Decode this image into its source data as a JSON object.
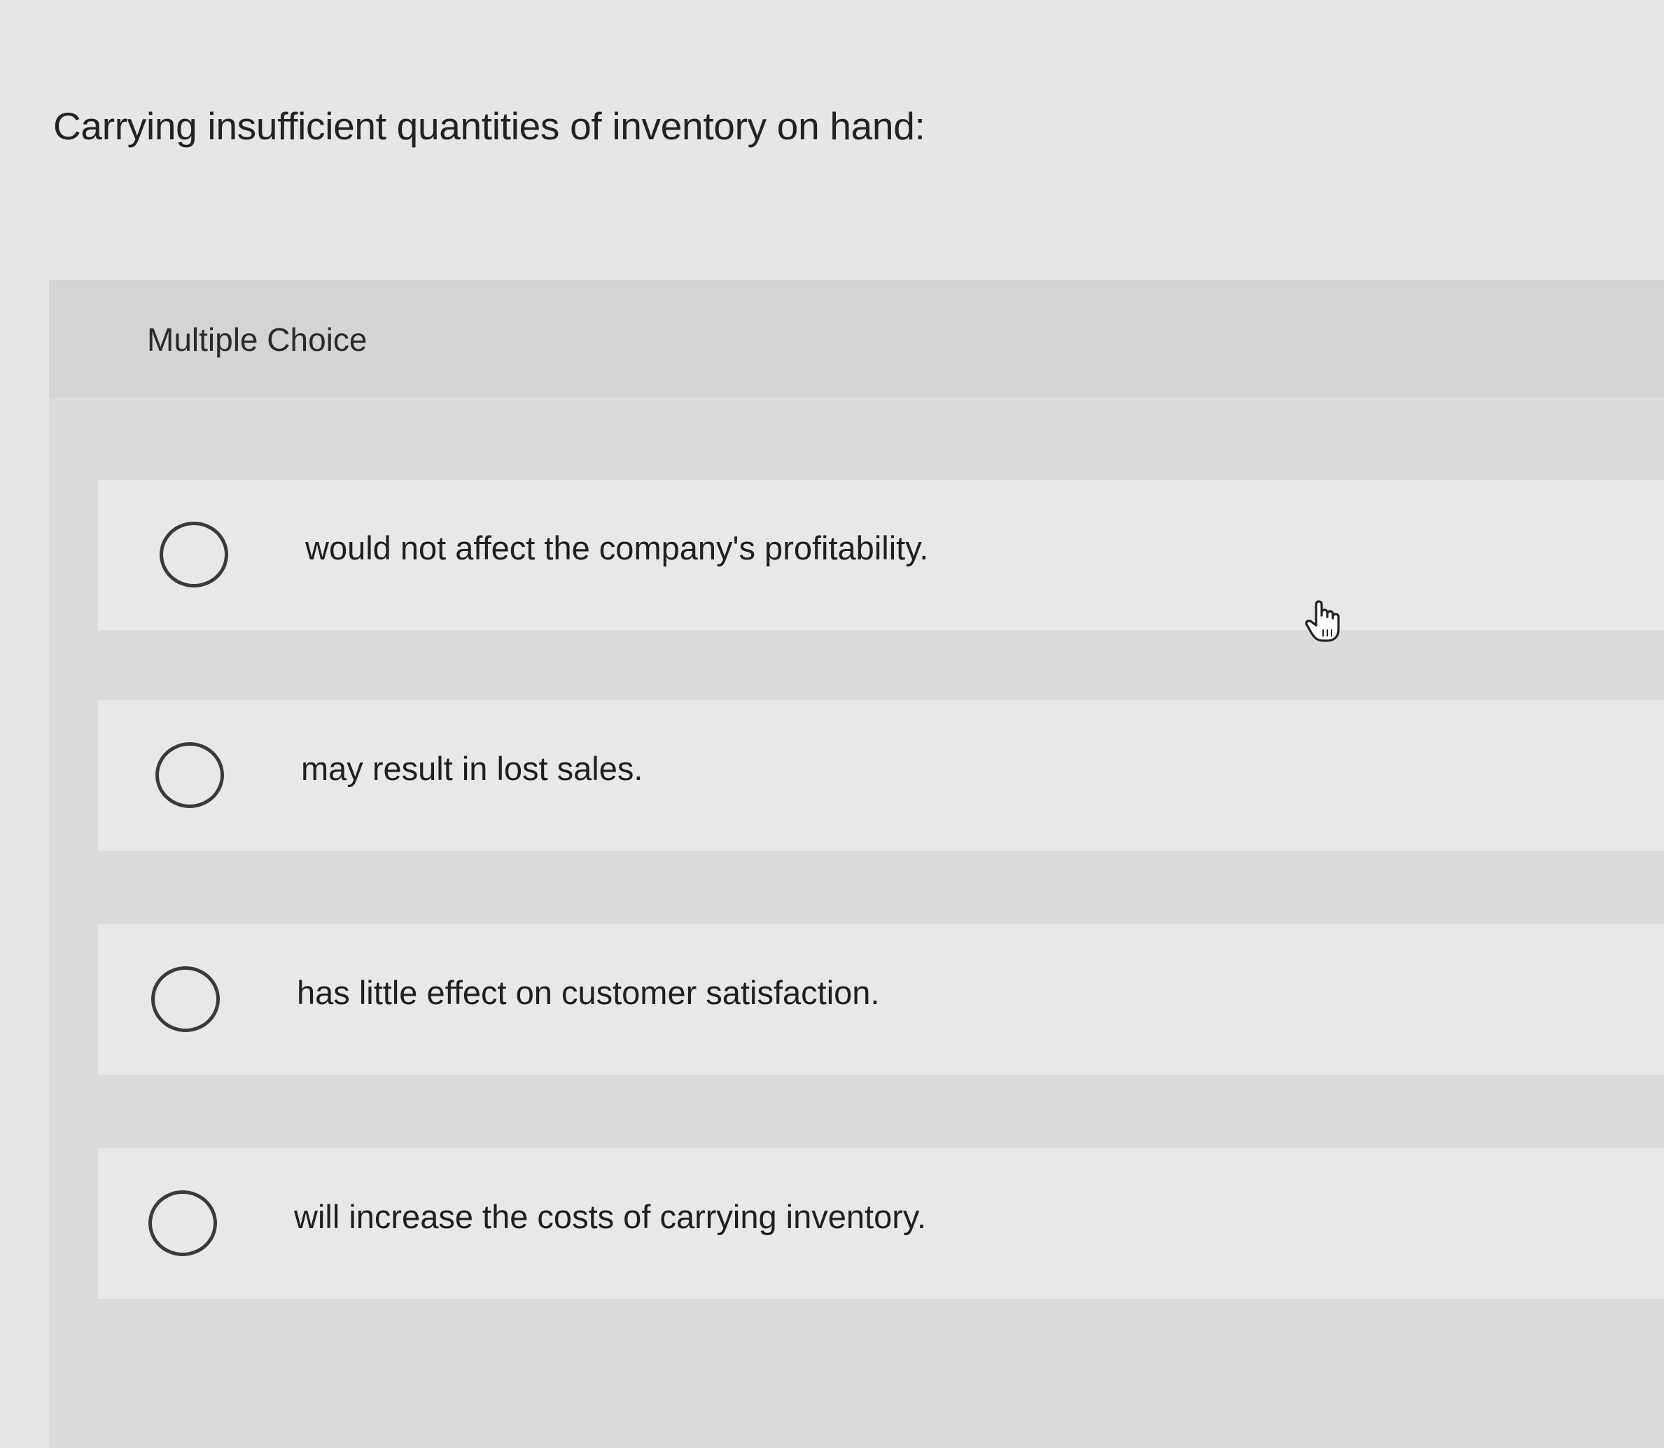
{
  "question": {
    "text": "Carrying insufficient quantities of inventory on hand:"
  },
  "choice_panel": {
    "label": "Multiple Choice",
    "options": [
      {
        "label": "would not affect the company's profitability."
      },
      {
        "label": "may result in lost sales."
      },
      {
        "label": "has little effect on customer satisfaction."
      },
      {
        "label": "will increase the costs of carrying inventory."
      }
    ]
  },
  "icons": {
    "radio": "radio-unselected-icon",
    "cursor": "hand-pointer-icon"
  },
  "colors": {
    "background": "#e6e6e4",
    "panel": "#dcdcda",
    "option_row": "#e8e8e6",
    "text": "#1f1f1f",
    "radio_border": "#3a3a3a"
  }
}
